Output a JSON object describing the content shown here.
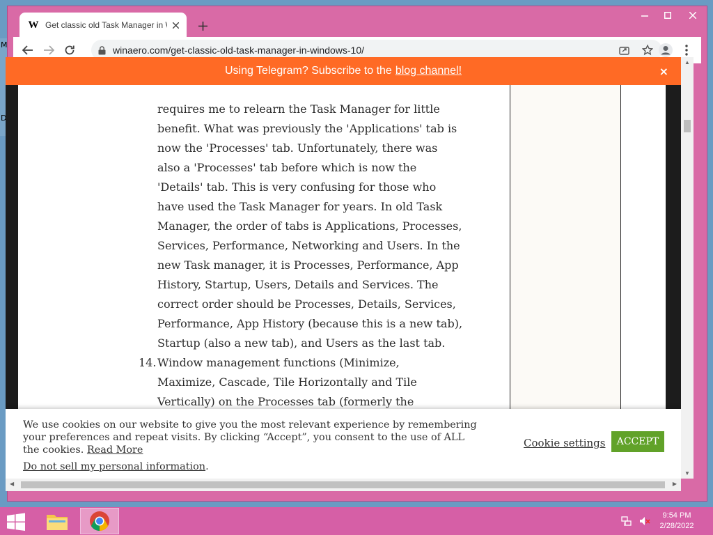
{
  "desktop": {
    "icon_label_1": "M",
    "icon_label_2": "D"
  },
  "window": {
    "minimize_label": "Minimize",
    "maximize_label": "Maximize",
    "close_label": "Close"
  },
  "tab": {
    "favicon": "W",
    "title": "Get classic old Task Manager in W"
  },
  "address": {
    "url": "winaero.com/get-classic-old-task-manager-in-windows-10/"
  },
  "banner": {
    "prefix": "Using Telegram? Subscribe to the",
    "link": "blog channel!",
    "close": "×"
  },
  "article": {
    "lines": [
      "requires me to relearn the Task Manager for little",
      "benefit. What was previously the 'Applications' tab is",
      "now the 'Processes' tab. Unfortunately, there was",
      "also a 'Processes' tab before which is now the",
      "'Details' tab. This is very confusing for those who",
      "have used the Task Manager for years. In old Task",
      "Manager, the order of tabs is Applications, Processes,",
      "Services, Performance, Networking and Users. In the",
      "new Task manager, it is Processes, Performance, App",
      "History, Startup, Users, Details and Services. The",
      "correct order should be Processes, Details, Services,",
      "Performance, App History (because this is a new tab),",
      "Startup (also a new tab), and Users as the last tab."
    ],
    "item14_number": "14.",
    "item14_lines": [
      "Window management functions (Minimize,",
      "Maximize, Cascade, Tile Horizontally and Tile",
      "Vertically) on the Processes tab (formerly the"
    ]
  },
  "cookie": {
    "text": "We use cookies on our website to give you the most relevant experience by remembering your preferences and repeat visits. By clicking “Accept”, you consent to the use of ALL the cookies.",
    "read_more": "Read More",
    "do_not_sell": "Do not sell my personal information",
    "do_not_sell_suffix": ".",
    "settings": "Cookie settings",
    "accept": "ACCEPT"
  },
  "taskbar": {
    "time": "9:54 PM",
    "date": "2/28/2022"
  },
  "colors": {
    "banner": "#ff6a25",
    "accept": "#61a229",
    "window_frame": "#d96aa6",
    "taskbar": "#d65fa6"
  }
}
